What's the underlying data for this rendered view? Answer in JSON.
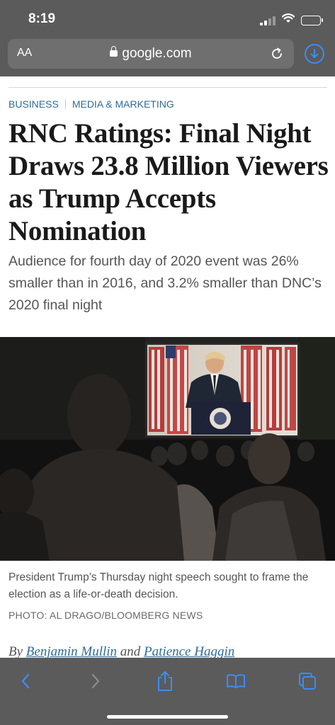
{
  "status": {
    "time": "8:19"
  },
  "browser": {
    "text_size_label": "AA",
    "url": "google.com",
    "icons": [
      "lock-icon",
      "reload-icon",
      "download-icon",
      "back-icon",
      "forward-icon",
      "share-icon",
      "bookmarks-icon",
      "tabs-icon"
    ],
    "accent_color": "#3d8cf5",
    "chrome_color": "#5b5b5b"
  },
  "article": {
    "breadcrumbs": [
      "BUSINESS",
      "MEDIA & MARKETING"
    ],
    "headline": "RNC Ratings: Final Night Draws 23.8 Million Viewers as Trump Accepts Nomination",
    "dek": "Audience for fourth day of 2020 event was 26% smaller than in 2016, and 3.2% smaller than DNC’s 2020 final night",
    "caption": "President Trump’s Thursday night speech sought to frame the election as a life-or-death decision.",
    "photo_credit": "PHOTO: AL DRAGO/BLOOMBERG NEWS",
    "byline": {
      "prefix": "By",
      "author1": "Benjamin Mullin",
      "conjunction": "and",
      "author2": "Patience Haggin"
    },
    "link_color": "#2e6c9e"
  }
}
